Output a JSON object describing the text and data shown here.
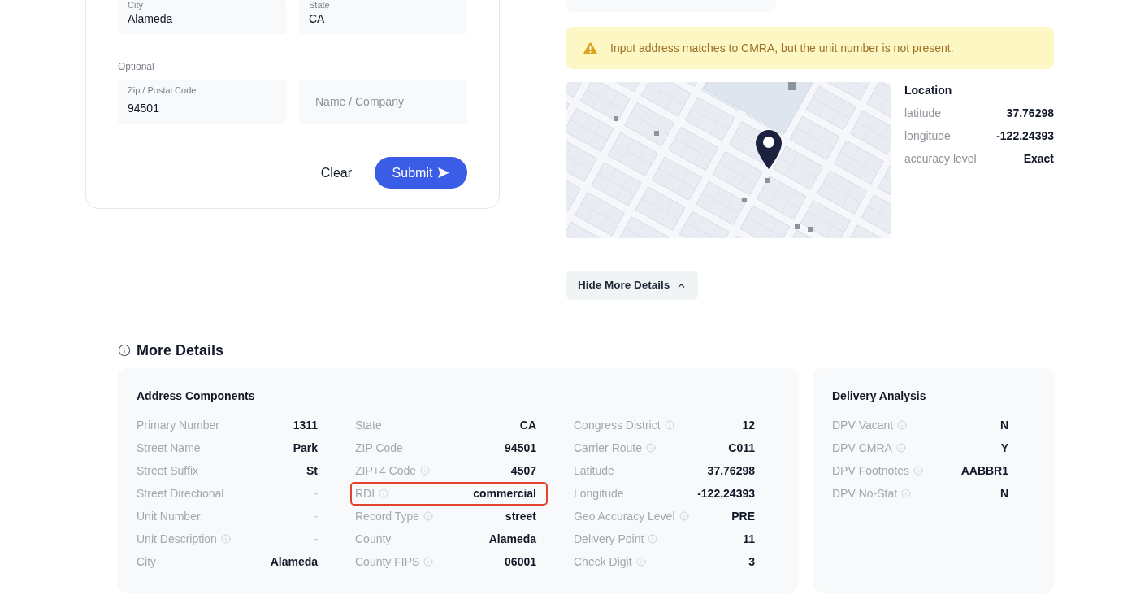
{
  "address_form": {
    "fields": [
      {
        "label": "City",
        "value": "Alameda"
      },
      {
        "label": "State",
        "value": "CA"
      }
    ],
    "optional_label": "Optional",
    "optional_fields": [
      {
        "label": "Zip / Postal Code",
        "value": "94501"
      },
      {
        "placeholder": "Name / Company"
      }
    ],
    "buttons": [
      {
        "label": "Clear",
        "kind": "text"
      },
      {
        "label": "Submit",
        "kind": "primary"
      }
    ]
  },
  "alert": {
    "message": "Input address matches to CMRA, but the unit number is not present."
  },
  "location": {
    "title": "Location",
    "rows": [
      {
        "label": "latitude",
        "value": "37.76298"
      },
      {
        "label": "longitude",
        "value": "-122.24393"
      },
      {
        "label": "accuracy level",
        "value": "Exact"
      }
    ]
  },
  "toggle_button": {
    "label": "Hide More Details",
    "expanded": true
  },
  "more_details": {
    "title": "More Details",
    "address_components": {
      "title": "Address Components",
      "columns": [
        {
          "rows": [
            {
              "label": "Primary Number",
              "value": "1311",
              "info": false,
              "muted": false,
              "highlighted": false
            },
            {
              "label": "Street Name",
              "value": "Park",
              "info": false,
              "muted": false,
              "highlighted": false
            },
            {
              "label": "Street Suffix",
              "value": "St",
              "info": false,
              "muted": false,
              "highlighted": false
            },
            {
              "label": "Street Directional",
              "value": "-",
              "info": false,
              "muted": true,
              "highlighted": false
            },
            {
              "label": "Unit Number",
              "value": "-",
              "info": false,
              "muted": true,
              "highlighted": false
            },
            {
              "label": "Unit Description",
              "value": "-",
              "info": true,
              "muted": true,
              "highlighted": false
            },
            {
              "label": "City",
              "value": "Alameda",
              "info": false,
              "muted": false,
              "highlighted": false
            }
          ]
        },
        {
          "rows": [
            {
              "label": "State",
              "value": "CA",
              "info": false,
              "muted": false,
              "highlighted": false
            },
            {
              "label": "ZIP Code",
              "value": "94501",
              "info": false,
              "muted": false,
              "highlighted": false
            },
            {
              "label": "ZIP+4 Code",
              "value": "4507",
              "info": true,
              "muted": false,
              "highlighted": false
            },
            {
              "label": "RDI",
              "value": "commercial",
              "info": true,
              "muted": false,
              "highlighted": true
            },
            {
              "label": "Record Type",
              "value": "street",
              "info": true,
              "muted": false,
              "highlighted": false
            },
            {
              "label": "County",
              "value": "Alameda",
              "info": false,
              "muted": false,
              "highlighted": false
            },
            {
              "label": "County FIPS",
              "value": "06001",
              "info": true,
              "muted": false,
              "highlighted": false
            }
          ]
        },
        {
          "rows": [
            {
              "label": "Congress District",
              "value": "12",
              "info": true,
              "muted": false,
              "highlighted": false
            },
            {
              "label": "Carrier Route",
              "value": "C011",
              "info": true,
              "muted": false,
              "highlighted": false
            },
            {
              "label": "Latitude",
              "value": "37.76298",
              "info": false,
              "muted": false,
              "highlighted": false
            },
            {
              "label": "Longitude",
              "value": "-122.24393",
              "info": false,
              "muted": false,
              "highlighted": false
            },
            {
              "label": "Geo Accuracy Level",
              "value": "PRE",
              "info": true,
              "muted": false,
              "highlighted": false
            },
            {
              "label": "Delivery Point",
              "value": "11",
              "info": true,
              "muted": false,
              "highlighted": false
            },
            {
              "label": "Check Digit",
              "value": "3",
              "info": true,
              "muted": false,
              "highlighted": false
            }
          ]
        }
      ]
    },
    "delivery_analysis": {
      "title": "Delivery Analysis",
      "rows": [
        {
          "label": "DPV Vacant",
          "value": "N",
          "info": true
        },
        {
          "label": "DPV CMRA",
          "value": "Y",
          "info": true
        },
        {
          "label": "DPV Footnotes",
          "value": "AABBR1",
          "info": true
        },
        {
          "label": "DPV No-Stat",
          "value": "N",
          "info": true
        }
      ]
    }
  }
}
